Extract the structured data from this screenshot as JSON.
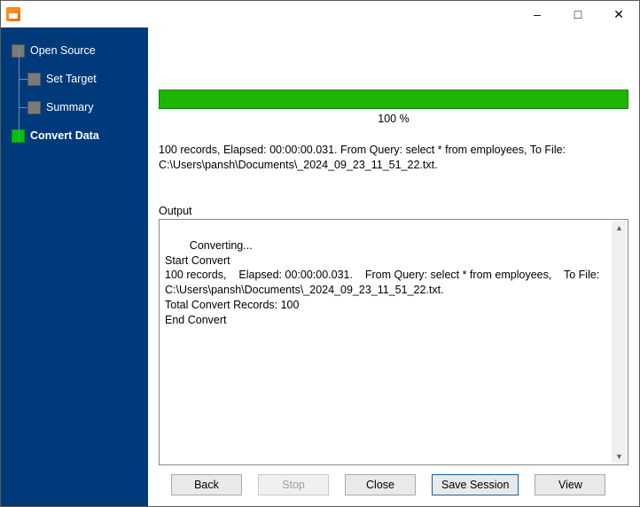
{
  "sidebar": {
    "items": [
      {
        "label": "Open Source"
      },
      {
        "label": "Set Target"
      },
      {
        "label": "Summary"
      },
      {
        "label": "Convert Data"
      }
    ]
  },
  "progress": {
    "percent_label": "100 %"
  },
  "status": {
    "text": "100 records,    Elapsed: 00:00:00.031.    From Query: select * from employees,    To File: C:\\Users\\pansh\\Documents\\_2024_09_23_11_51_22.txt."
  },
  "output": {
    "label": "Output",
    "text": "Converting...\nStart Convert\n100 records,    Elapsed: 00:00:00.031.    From Query: select * from employees,    To File: C:\\Users\\pansh\\Documents\\_2024_09_23_11_51_22.txt.\nTotal Convert Records: 100\nEnd Convert"
  },
  "buttons": {
    "back": "Back",
    "stop": "Stop",
    "close": "Close",
    "save_session": "Save Session",
    "view": "View"
  }
}
